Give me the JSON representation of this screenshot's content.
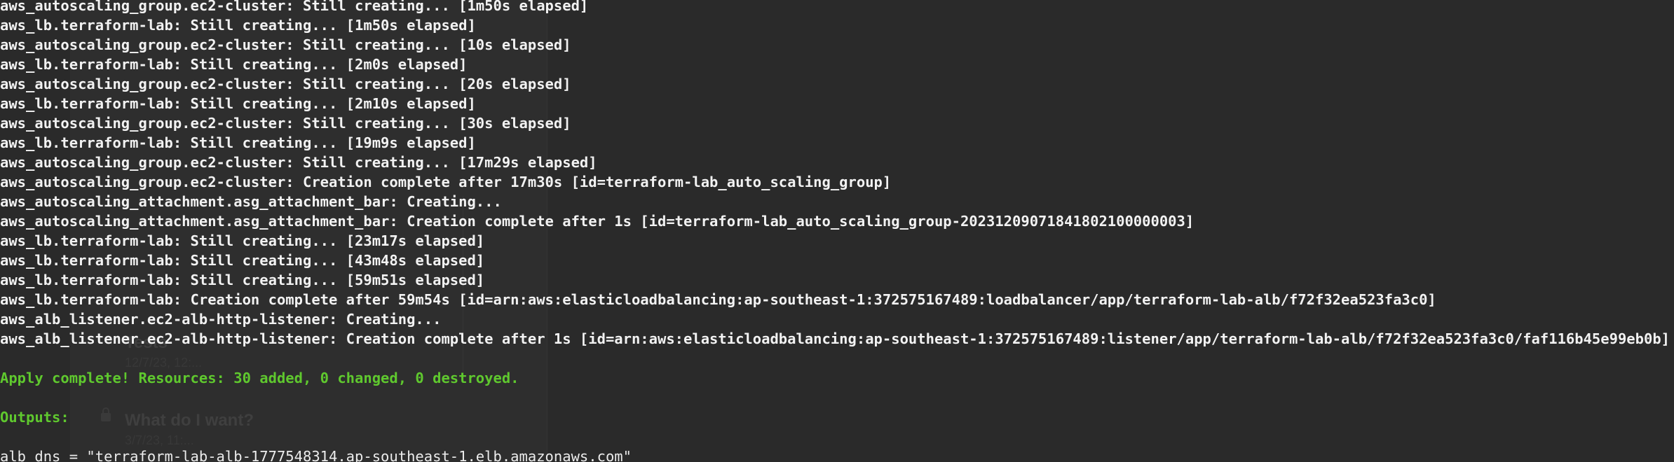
{
  "terminal": {
    "lines": [
      {
        "text": "aws_autoscaling_group.ec2-cluster: Still creating... [1m50s elapsed]",
        "style": "bold"
      },
      {
        "text": "aws_lb.terraform-lab: Still creating... [1m50s elapsed]",
        "style": "bold"
      },
      {
        "text": "aws_autoscaling_group.ec2-cluster: Still creating... [10s elapsed]",
        "style": "bold"
      },
      {
        "text": "aws_lb.terraform-lab: Still creating... [2m0s elapsed]",
        "style": "bold"
      },
      {
        "text": "aws_autoscaling_group.ec2-cluster: Still creating... [20s elapsed]",
        "style": "bold"
      },
      {
        "text": "aws_lb.terraform-lab: Still creating... [2m10s elapsed]",
        "style": "bold"
      },
      {
        "text": "aws_autoscaling_group.ec2-cluster: Still creating... [30s elapsed]",
        "style": "bold"
      },
      {
        "text": "aws_lb.terraform-lab: Still creating... [19m9s elapsed]",
        "style": "bold"
      },
      {
        "text": "aws_autoscaling_group.ec2-cluster: Still creating... [17m29s elapsed]",
        "style": "bold"
      },
      {
        "text": "aws_autoscaling_group.ec2-cluster: Creation complete after 17m30s [id=terraform-lab_auto_scaling_group]",
        "style": "bold"
      },
      {
        "text": "aws_autoscaling_attachment.asg_attachment_bar: Creating...",
        "style": "bold"
      },
      {
        "text": "aws_autoscaling_attachment.asg_attachment_bar: Creation complete after 1s [id=terraform-lab_auto_scaling_group-20231209071841802100000003]",
        "style": "bold"
      },
      {
        "text": "aws_lb.terraform-lab: Still creating... [23m17s elapsed]",
        "style": "bold"
      },
      {
        "text": "aws_lb.terraform-lab: Still creating... [43m48s elapsed]",
        "style": "bold"
      },
      {
        "text": "aws_lb.terraform-lab: Still creating... [59m51s elapsed]",
        "style": "bold"
      },
      {
        "text": "aws_lb.terraform-lab: Creation complete after 59m54s [id=arn:aws:elasticloadbalancing:ap-southeast-1:372575167489:loadbalancer/app/terraform-lab-alb/f72f32ea523fa3c0]",
        "style": "bold"
      },
      {
        "text": "aws_alb_listener.ec2-alb-http-listener: Creating...",
        "style": "bold"
      },
      {
        "text": "aws_alb_listener.ec2-alb-http-listener: Creation complete after 1s [id=arn:aws:elasticloadbalancing:ap-southeast-1:372575167489:listener/app/terraform-lab-alb/f72f32ea523fa3c0/faf116b45e99eb0b]",
        "style": "bold"
      },
      {
        "text": "",
        "style": "bold"
      },
      {
        "text": "Apply complete! Resources: 30 added, 0 changed, 0 destroyed.",
        "style": "green"
      },
      {
        "text": "",
        "style": "bold"
      },
      {
        "text": "Outputs:",
        "style": "green"
      },
      {
        "text": "",
        "style": "bold"
      },
      {
        "text": "alb_dns = \"terraform-lab-alb-1777548314.ap-southeast-1.elb.amazonaws.com\"",
        "style": "normal"
      }
    ]
  },
  "background_window": {
    "items": [
      {
        "title": "Tests",
        "subtitle": "12/7/23, 12:..."
      },
      {
        "title": "What do I want?",
        "subtitle": "3/7/23, 11:..."
      }
    ]
  },
  "colors": {
    "background": "#2a2a2a",
    "text": "#f2f2f2",
    "success": "#5fc82e"
  }
}
